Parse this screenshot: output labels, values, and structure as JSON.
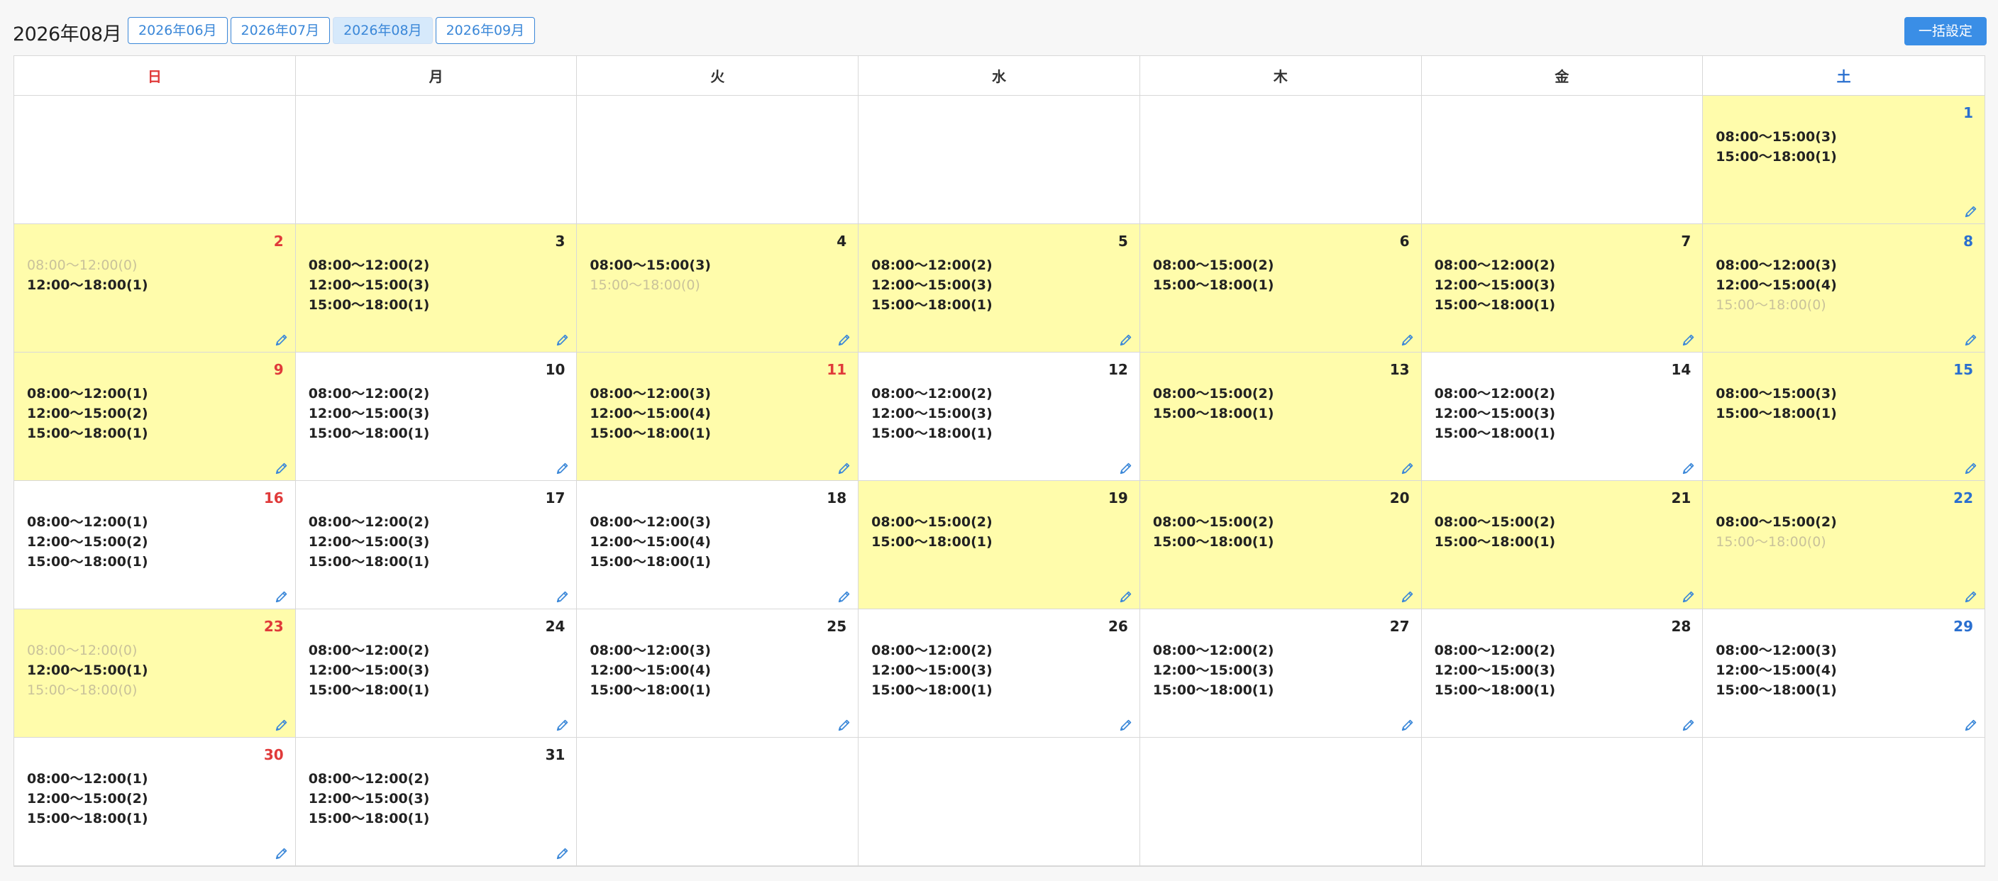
{
  "header": {
    "title": "2026年08月",
    "months": [
      "2026年06月",
      "2026年07月",
      "2026年08月",
      "2026年09月"
    ],
    "active_month_index": 2,
    "bulk_button": "一括設定"
  },
  "weekdays": [
    "日",
    "月",
    "火",
    "水",
    "木",
    "金",
    "土"
  ],
  "colors": {
    "sunday": "#e03a3a",
    "saturday": "#2a6fcf",
    "highlight": "#fffcab",
    "accent": "#3a8ee6"
  },
  "weeks": [
    [
      null,
      null,
      null,
      null,
      null,
      null,
      {
        "day": "1",
        "highlight": true,
        "slots": [
          {
            "t": "08:00〜15:00(3)"
          },
          {
            "t": "15:00〜18:00(1)"
          }
        ]
      }
    ],
    [
      {
        "day": "2",
        "highlight": true,
        "slots": [
          {
            "t": "08:00〜12:00(0)",
            "muted": true
          },
          {
            "t": "12:00〜18:00(1)"
          }
        ]
      },
      {
        "day": "3",
        "highlight": true,
        "slots": [
          {
            "t": "08:00〜12:00(2)"
          },
          {
            "t": "12:00〜15:00(3)"
          },
          {
            "t": "15:00〜18:00(1)"
          }
        ]
      },
      {
        "day": "4",
        "highlight": true,
        "slots": [
          {
            "t": "08:00〜15:00(3)"
          },
          {
            "t": "15:00〜18:00(0)",
            "muted": true
          }
        ]
      },
      {
        "day": "5",
        "highlight": true,
        "slots": [
          {
            "t": "08:00〜12:00(2)"
          },
          {
            "t": "12:00〜15:00(3)"
          },
          {
            "t": "15:00〜18:00(1)"
          }
        ]
      },
      {
        "day": "6",
        "highlight": true,
        "slots": [
          {
            "t": "08:00〜15:00(2)"
          },
          {
            "t": "15:00〜18:00(1)"
          }
        ]
      },
      {
        "day": "7",
        "highlight": true,
        "slots": [
          {
            "t": "08:00〜12:00(2)"
          },
          {
            "t": "12:00〜15:00(3)"
          },
          {
            "t": "15:00〜18:00(1)"
          }
        ]
      },
      {
        "day": "8",
        "highlight": true,
        "slots": [
          {
            "t": "08:00〜12:00(3)"
          },
          {
            "t": "12:00〜15:00(4)"
          },
          {
            "t": "15:00〜18:00(0)",
            "muted": true
          }
        ]
      }
    ],
    [
      {
        "day": "9",
        "highlight": true,
        "slots": [
          {
            "t": "08:00〜12:00(1)"
          },
          {
            "t": "12:00〜15:00(2)"
          },
          {
            "t": "15:00〜18:00(1)"
          }
        ]
      },
      {
        "day": "10",
        "highlight": false,
        "slots": [
          {
            "t": "08:00〜12:00(2)"
          },
          {
            "t": "12:00〜15:00(3)"
          },
          {
            "t": "15:00〜18:00(1)"
          }
        ]
      },
      {
        "day": "11",
        "highlight": true,
        "red": true,
        "slots": [
          {
            "t": "08:00〜12:00(3)"
          },
          {
            "t": "12:00〜15:00(4)"
          },
          {
            "t": "15:00〜18:00(1)"
          }
        ]
      },
      {
        "day": "12",
        "highlight": false,
        "slots": [
          {
            "t": "08:00〜12:00(2)"
          },
          {
            "t": "12:00〜15:00(3)"
          },
          {
            "t": "15:00〜18:00(1)"
          }
        ]
      },
      {
        "day": "13",
        "highlight": true,
        "slots": [
          {
            "t": "08:00〜15:00(2)"
          },
          {
            "t": "15:00〜18:00(1)"
          }
        ]
      },
      {
        "day": "14",
        "highlight": false,
        "slots": [
          {
            "t": "08:00〜12:00(2)"
          },
          {
            "t": "12:00〜15:00(3)"
          },
          {
            "t": "15:00〜18:00(1)"
          }
        ]
      },
      {
        "day": "15",
        "highlight": true,
        "slots": [
          {
            "t": "08:00〜15:00(3)"
          },
          {
            "t": "15:00〜18:00(1)"
          }
        ]
      }
    ],
    [
      {
        "day": "16",
        "highlight": false,
        "slots": [
          {
            "t": "08:00〜12:00(1)"
          },
          {
            "t": "12:00〜15:00(2)"
          },
          {
            "t": "15:00〜18:00(1)"
          }
        ]
      },
      {
        "day": "17",
        "highlight": false,
        "slots": [
          {
            "t": "08:00〜12:00(2)"
          },
          {
            "t": "12:00〜15:00(3)"
          },
          {
            "t": "15:00〜18:00(1)"
          }
        ]
      },
      {
        "day": "18",
        "highlight": false,
        "slots": [
          {
            "t": "08:00〜12:00(3)"
          },
          {
            "t": "12:00〜15:00(4)"
          },
          {
            "t": "15:00〜18:00(1)"
          }
        ]
      },
      {
        "day": "19",
        "highlight": true,
        "slots": [
          {
            "t": "08:00〜15:00(2)"
          },
          {
            "t": "15:00〜18:00(1)"
          }
        ]
      },
      {
        "day": "20",
        "highlight": true,
        "slots": [
          {
            "t": "08:00〜15:00(2)"
          },
          {
            "t": "15:00〜18:00(1)"
          }
        ]
      },
      {
        "day": "21",
        "highlight": true,
        "slots": [
          {
            "t": "08:00〜15:00(2)"
          },
          {
            "t": "15:00〜18:00(1)"
          }
        ]
      },
      {
        "day": "22",
        "highlight": true,
        "slots": [
          {
            "t": "08:00〜15:00(2)"
          },
          {
            "t": "15:00〜18:00(0)",
            "muted": true
          }
        ]
      }
    ],
    [
      {
        "day": "23",
        "highlight": true,
        "slots": [
          {
            "t": "08:00〜12:00(0)",
            "muted": true
          },
          {
            "t": "12:00〜15:00(1)"
          },
          {
            "t": "15:00〜18:00(0)",
            "muted": true
          }
        ]
      },
      {
        "day": "24",
        "highlight": false,
        "slots": [
          {
            "t": "08:00〜12:00(2)"
          },
          {
            "t": "12:00〜15:00(3)"
          },
          {
            "t": "15:00〜18:00(1)"
          }
        ]
      },
      {
        "day": "25",
        "highlight": false,
        "slots": [
          {
            "t": "08:00〜12:00(3)"
          },
          {
            "t": "12:00〜15:00(4)"
          },
          {
            "t": "15:00〜18:00(1)"
          }
        ]
      },
      {
        "day": "26",
        "highlight": false,
        "slots": [
          {
            "t": "08:00〜12:00(2)"
          },
          {
            "t": "12:00〜15:00(3)"
          },
          {
            "t": "15:00〜18:00(1)"
          }
        ]
      },
      {
        "day": "27",
        "highlight": false,
        "slots": [
          {
            "t": "08:00〜12:00(2)"
          },
          {
            "t": "12:00〜15:00(3)"
          },
          {
            "t": "15:00〜18:00(1)"
          }
        ]
      },
      {
        "day": "28",
        "highlight": false,
        "slots": [
          {
            "t": "08:00〜12:00(2)"
          },
          {
            "t": "12:00〜15:00(3)"
          },
          {
            "t": "15:00〜18:00(1)"
          }
        ]
      },
      {
        "day": "29",
        "highlight": false,
        "slots": [
          {
            "t": "08:00〜12:00(3)"
          },
          {
            "t": "12:00〜15:00(4)"
          },
          {
            "t": "15:00〜18:00(1)"
          }
        ]
      }
    ],
    [
      {
        "day": "30",
        "highlight": false,
        "slots": [
          {
            "t": "08:00〜12:00(1)"
          },
          {
            "t": "12:00〜15:00(2)"
          },
          {
            "t": "15:00〜18:00(1)"
          }
        ]
      },
      {
        "day": "31",
        "highlight": false,
        "slots": [
          {
            "t": "08:00〜12:00(2)"
          },
          {
            "t": "12:00〜15:00(3)"
          },
          {
            "t": "15:00〜18:00(1)"
          }
        ]
      },
      null,
      null,
      null,
      null,
      null
    ]
  ]
}
